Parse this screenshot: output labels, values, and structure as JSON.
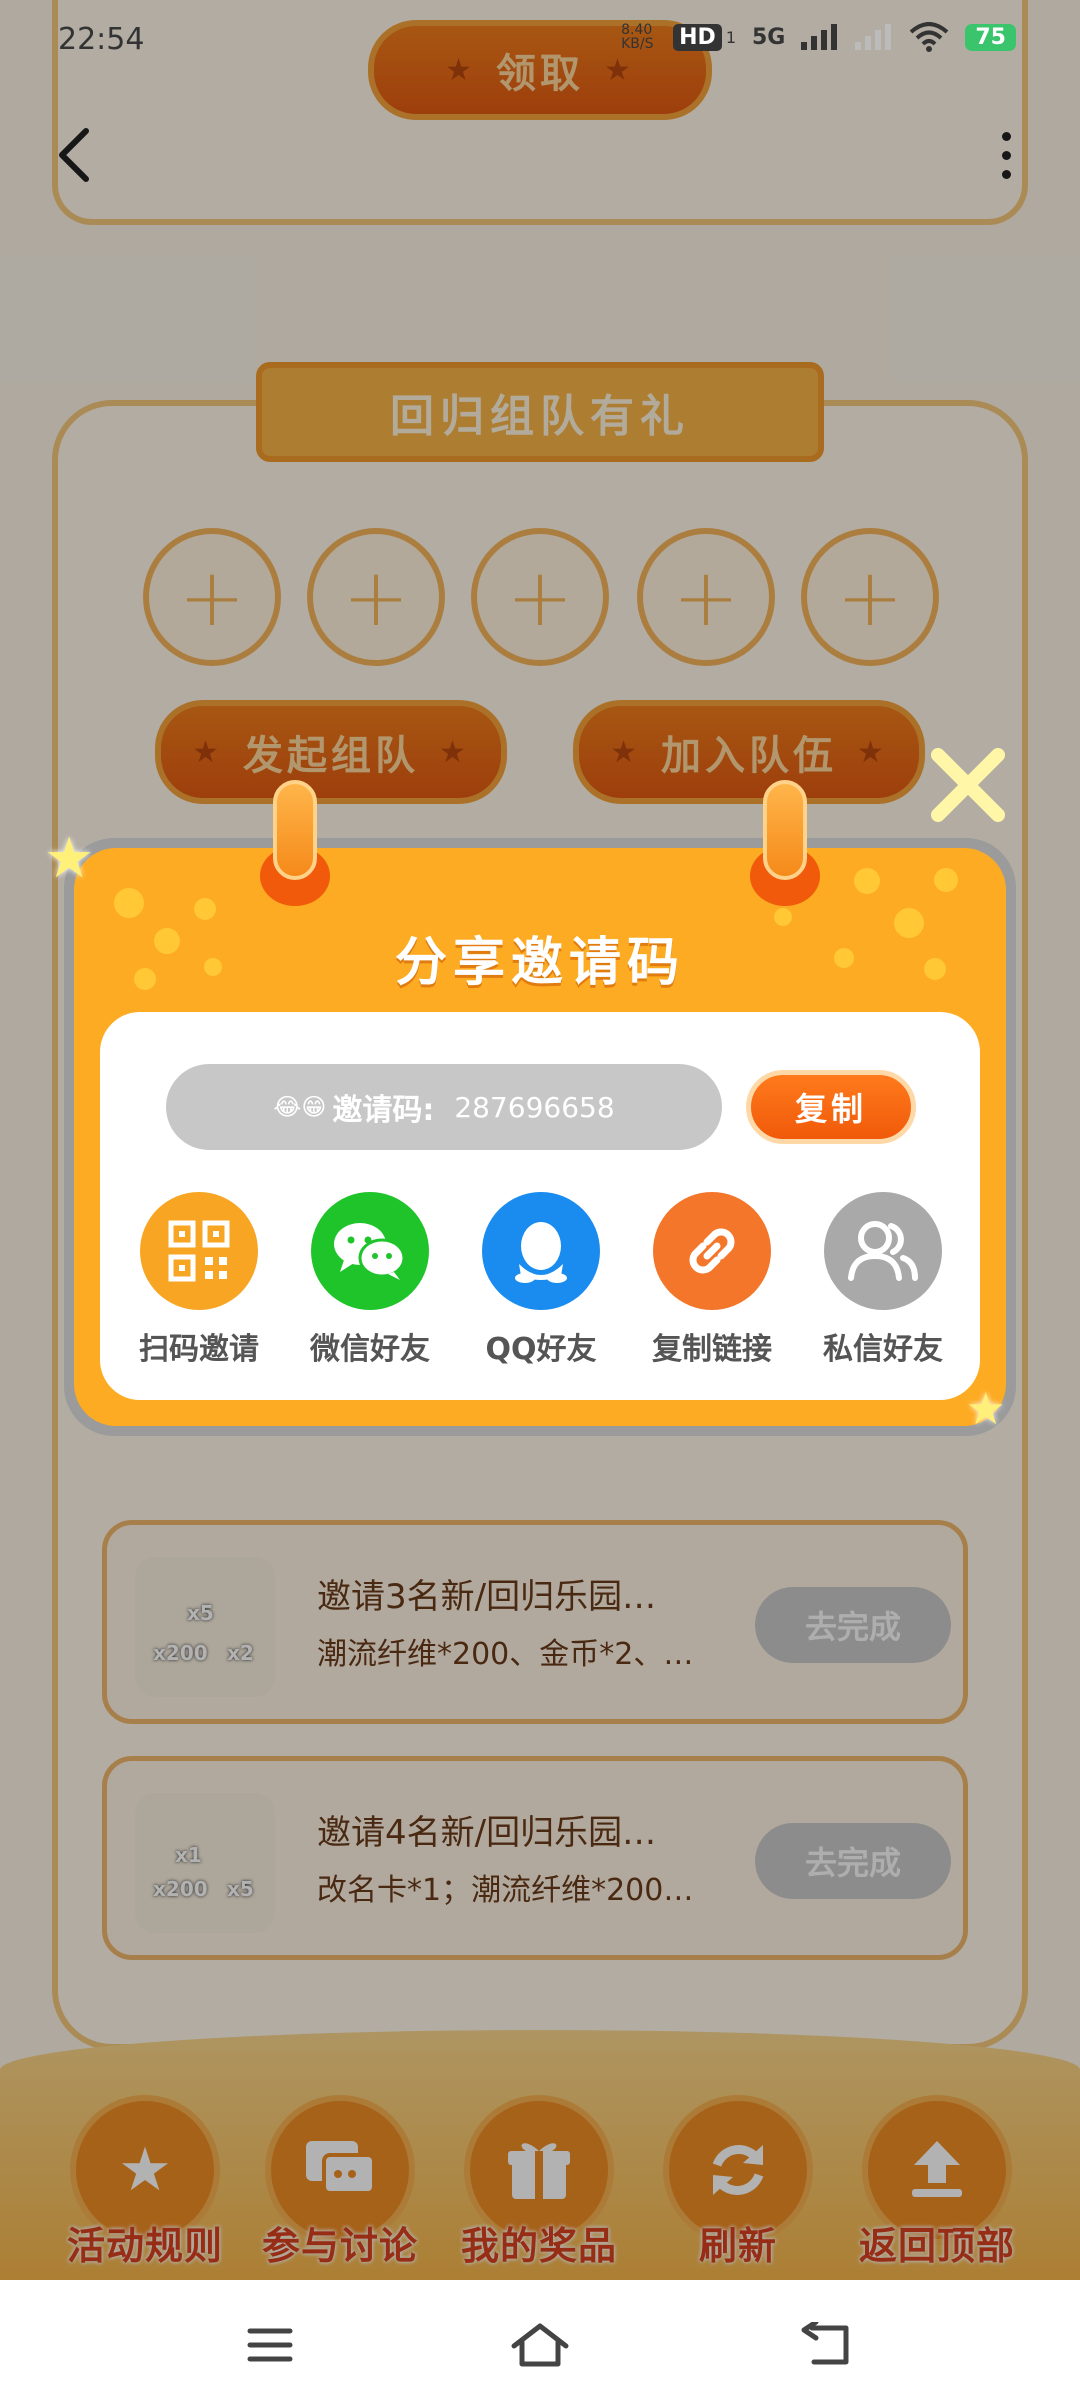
{
  "status_bar": {
    "time": "22:54",
    "net_speed": "8.40 KB/S",
    "hd": "HD",
    "sim": "1",
    "network": "5G",
    "battery": "75"
  },
  "header": {
    "claim_button": "领取",
    "back_icon": "back-arrow-icon",
    "more_icon": "more-vert-icon"
  },
  "team": {
    "title": "回归组队有礼",
    "slots": [
      "+",
      "+",
      "+",
      "+",
      "+"
    ],
    "start_button": "发起组队",
    "join_button": "加入队伍"
  },
  "tasks": [
    {
      "title": "邀请3名新/回归乐园…",
      "desc": "潮流纤维*200、金币*2、…",
      "button": "去完成",
      "thumb_counts": [
        "x5",
        "x200",
        "x2"
      ]
    },
    {
      "title": "邀请4名新/回归乐园…",
      "desc": "改名卡*1；潮流纤维*200…",
      "button": "去完成",
      "thumb_counts": [
        "x1",
        "x200",
        "x5"
      ]
    }
  ],
  "bottom_bar": [
    {
      "label": "活动规则",
      "icon": "star-icon"
    },
    {
      "label": "参与讨论",
      "icon": "chat-icon"
    },
    {
      "label": "我的奖品",
      "icon": "gift-icon"
    },
    {
      "label": "刷新",
      "icon": "refresh-icon"
    },
    {
      "label": "返回顶部",
      "icon": "upload-icon"
    }
  ],
  "share_modal": {
    "title": "分享邀请码",
    "code_emoji": "😂😁",
    "code_label": "邀请码:",
    "code_value": "287696658",
    "copy_button": "复制",
    "options": [
      {
        "label": "扫码邀请",
        "icon": "qrcode-icon",
        "color": "#f8a523"
      },
      {
        "label": "微信好友",
        "icon": "wechat-icon",
        "color": "#1fc42a"
      },
      {
        "label": "QQ好友",
        "icon": "qq-icon",
        "color": "#1a8cf0"
      },
      {
        "label": "复制链接",
        "icon": "link-icon",
        "color": "#f3762a"
      },
      {
        "label": "私信好友",
        "icon": "users-icon",
        "color": "#a9a9a9"
      }
    ]
  },
  "nav_bar": [
    "menu-icon",
    "home-icon",
    "back-icon"
  ]
}
